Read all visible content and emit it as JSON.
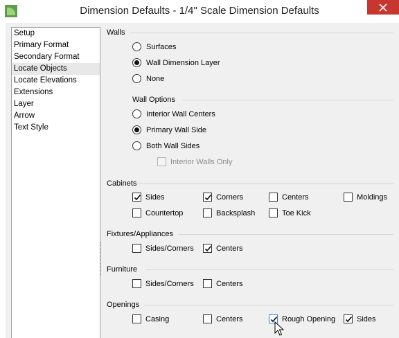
{
  "window": {
    "title": "Dimension Defaults - 1/4\" Scale Dimension Defaults",
    "accent_close": "#c7372f"
  },
  "nav": {
    "items": [
      {
        "label": "Setup",
        "selected": false
      },
      {
        "label": "Primary Format",
        "selected": false
      },
      {
        "label": "Secondary Format",
        "selected": false
      },
      {
        "label": "Locate Objects",
        "selected": true
      },
      {
        "label": "Locate Elevations",
        "selected": false
      },
      {
        "label": "Extensions",
        "selected": false
      },
      {
        "label": "Layer",
        "selected": false
      },
      {
        "label": "Arrow",
        "selected": false
      },
      {
        "label": "Text Style",
        "selected": false
      }
    ]
  },
  "walls": {
    "title": "Walls",
    "options": [
      {
        "label": "Surfaces",
        "checked": false
      },
      {
        "label": "Wall Dimension Layer",
        "checked": true
      },
      {
        "label": "None",
        "checked": false
      }
    ],
    "wall_options_title": "Wall Options",
    "wall_options": [
      {
        "label": "Interior Wall Centers",
        "checked": false
      },
      {
        "label": "Primary Wall Side",
        "checked": true
      },
      {
        "label": "Both Wall Sides",
        "checked": false
      }
    ],
    "interior_walls_only": {
      "label": "Interior Walls Only",
      "checked": false,
      "disabled": true
    }
  },
  "cabinets": {
    "title": "Cabinets",
    "items": [
      {
        "label": "Sides",
        "checked": true
      },
      {
        "label": "Corners",
        "checked": true
      },
      {
        "label": "Centers",
        "checked": false
      },
      {
        "label": "Moldings",
        "checked": false
      },
      {
        "label": "Countertop",
        "checked": false
      },
      {
        "label": "Backsplash",
        "checked": false
      },
      {
        "label": "Toe Kick",
        "checked": false
      }
    ]
  },
  "fixtures": {
    "title": "Fixtures/Appliances",
    "items": [
      {
        "label": "Sides/Corners",
        "checked": false
      },
      {
        "label": "Centers",
        "checked": true
      }
    ]
  },
  "furniture": {
    "title": "Furniture",
    "items": [
      {
        "label": "Sides/Corners",
        "checked": false
      },
      {
        "label": "Centers",
        "checked": false
      }
    ]
  },
  "openings": {
    "title": "Openings",
    "items": [
      {
        "label": "Casing",
        "checked": false
      },
      {
        "label": "Centers",
        "checked": false
      },
      {
        "label": "Rough Opening",
        "checked": true
      },
      {
        "label": "Sides",
        "checked": true
      }
    ]
  }
}
